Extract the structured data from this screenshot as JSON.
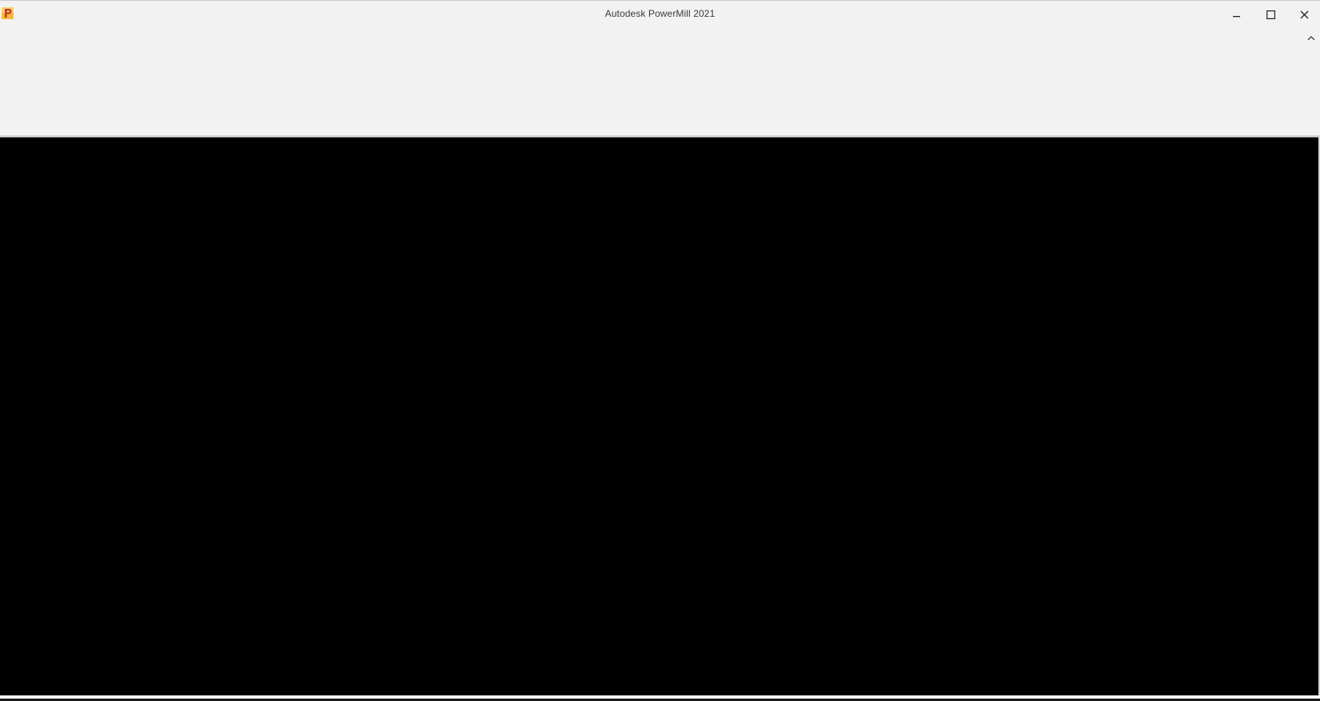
{
  "window": {
    "title": "Autodesk PowerMill 2021",
    "app_icon": "powermill-p-icon",
    "accent_color": "#f5a623"
  },
  "controls": {
    "minimize_icon": "minimize-icon",
    "maximize_icon": "maximize-icon",
    "close_icon": "close-icon"
  },
  "ribbon": {
    "collapse_icon": "chevron-up-icon"
  },
  "viewport": {
    "background_color": "#000000"
  }
}
